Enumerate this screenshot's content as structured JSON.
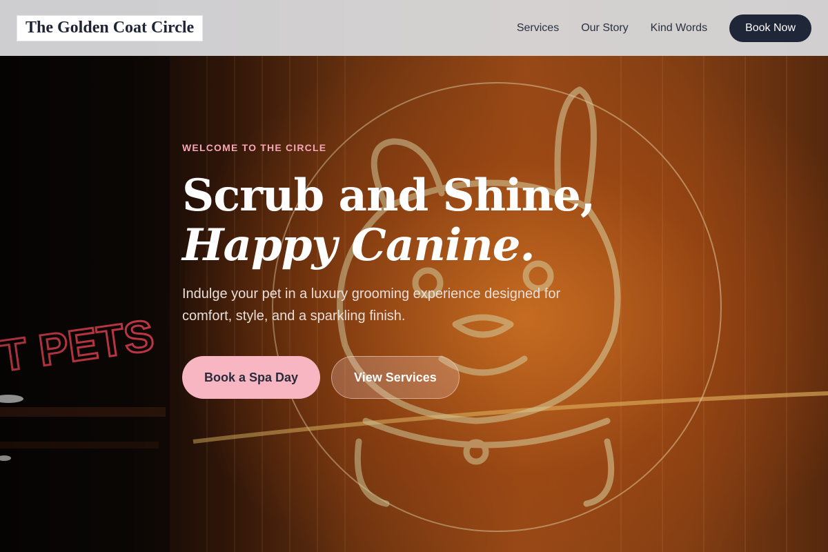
{
  "header": {
    "logo_text": "The Golden Coat Circle",
    "nav": [
      {
        "label": "Services"
      },
      {
        "label": "Our Story"
      },
      {
        "label": "Kind Words"
      }
    ],
    "cta_label": "Book Now"
  },
  "hero": {
    "eyebrow": "WELCOME TO THE CIRCLE",
    "headline_line1": "Scrub and Shine,",
    "headline_line2": "Happy Canine.",
    "subtext": "Indulge your pet in a luxury grooming experience designed for comfort, style, and a sparkling finish.",
    "primary_cta": "Book a Spa Day",
    "secondary_cta": "View Services",
    "background_image": {
      "description_icon": "neon-dog-sign-image",
      "sign_text": "PETS"
    }
  },
  "colors": {
    "header_bg": "#d6d6d8",
    "cta_dark": "#1e2637",
    "accent_pink": "#f8b6c2",
    "eyebrow_pink": "#f7a6b6",
    "neon_orange": "#e88028"
  }
}
